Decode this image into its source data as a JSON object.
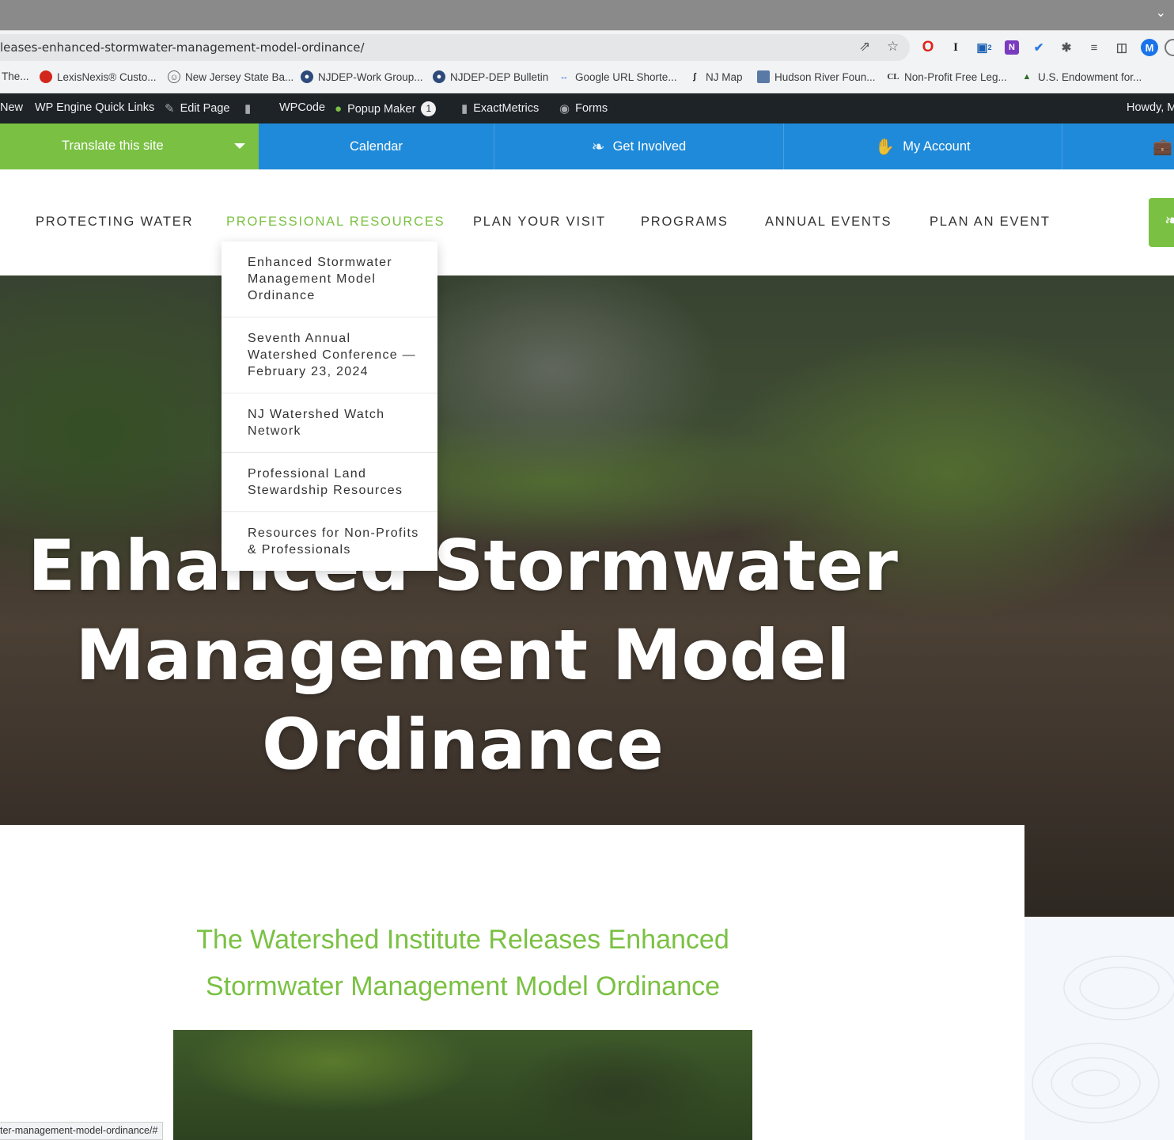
{
  "browser": {
    "url": "leases-enhanced-stormwater-management-model-ordinance/",
    "bookmarks": [
      "The...",
      "LexisNexis® Custo...",
      "New Jersey State Ba...",
      "NJDEP-Work Group...",
      "NJDEP-DEP Bulletin",
      "Google URL Shorte...",
      "NJ Map",
      "Hudson River Foun...",
      "Non-Profit Free Leg...",
      "U.S. Endowment for..."
    ],
    "profile_initial": "M",
    "extension_badge": "2",
    "status_url": "ter-management-model-ordinance/#"
  },
  "admin_bar": {
    "new": "New",
    "quick_links": "WP Engine Quick Links",
    "edit_page": "Edit Page",
    "wpcode": "WPCode",
    "popup_maker": "Popup Maker",
    "popup_count": "1",
    "exactmetrics": "ExactMetrics",
    "forms": "Forms",
    "howdy": "Howdy, M"
  },
  "topstrip": {
    "translate": "Translate this site",
    "links": [
      "Calendar",
      "Get Involved",
      "My Account"
    ]
  },
  "nav": {
    "items": [
      "PROTECTING WATER",
      "PROFESSIONAL RESOURCES",
      "PLAN YOUR VISIT",
      "PROGRAMS",
      "ANNUAL EVENTS",
      "PLAN AN EVENT"
    ],
    "active_index": 1
  },
  "dropdown": {
    "items": [
      "Enhanced Stormwater Management Model Ordinance",
      "Seventh Annual Watershed Conference — February 23, 2024",
      "NJ Watershed Watch Network",
      "Professional Land Stewardship Resources",
      "Resources for Non-Profits & Professionals"
    ]
  },
  "hero": {
    "title_line1": "Enhanced Stormwater",
    "title_line2": "Management Model",
    "title_line3": "Ordinance"
  },
  "content": {
    "heading_line1": "The Watershed Institute Releases Enhanced",
    "heading_line2": "Stormwater Management Model Ordinance"
  },
  "colors": {
    "green": "#7ac143",
    "blue": "#1f8ad9",
    "admin_bar": "#1d2327"
  },
  "icons": [
    "share-icon",
    "star-icon",
    "opera-icon",
    "feather-icon",
    "hand-icon",
    "briefcase-icon",
    "leaf-icon"
  ]
}
